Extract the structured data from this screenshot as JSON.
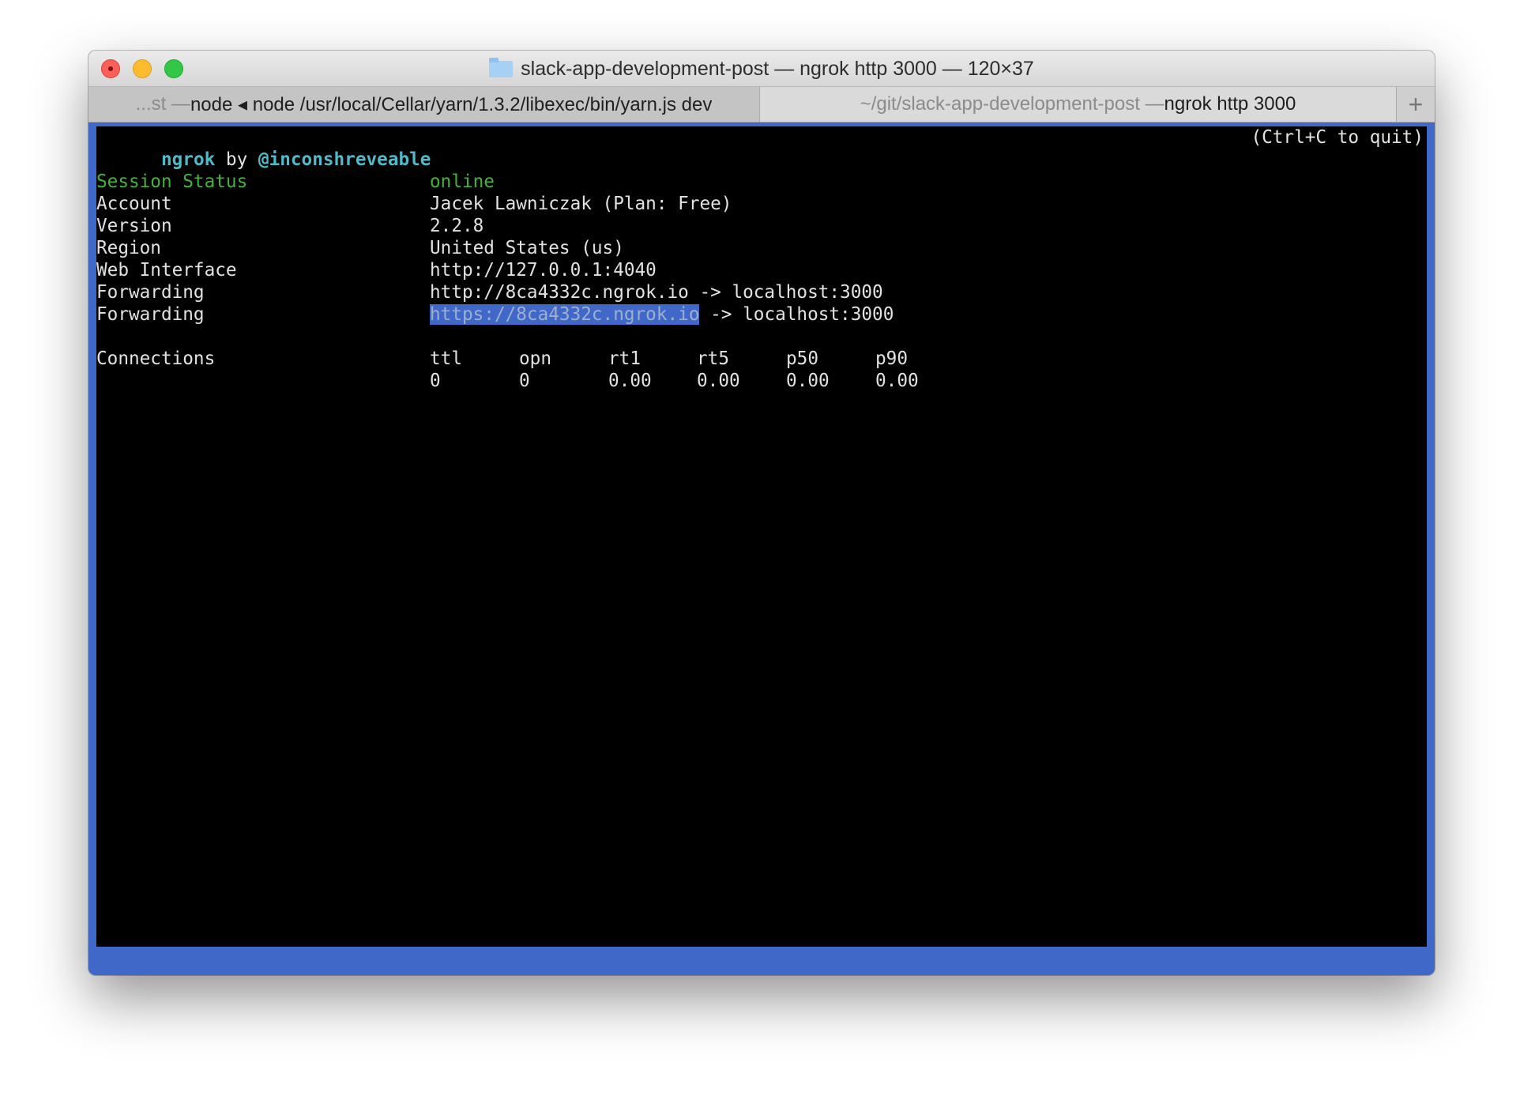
{
  "window": {
    "title": "slack-app-development-post — ngrok http 3000 — 120×37",
    "folder_icon": "folder-icon",
    "colors": {
      "selection": "#3f68c8",
      "accent_cyan": "#52b9c8",
      "status_green": "#46b13c",
      "background": "#000000"
    }
  },
  "tabs": [
    {
      "prefix": "...st — ",
      "label": "node ◂ node /usr/local/Cellar/yarn/1.3.2/libexec/bin/yarn.js dev"
    },
    {
      "prefix": "~/git/slack-app-development-post — ",
      "label": "ngrok http 3000"
    }
  ],
  "newtab_label": "+",
  "terminal": {
    "header": {
      "app": "ngrok",
      "by": " by ",
      "author": "@inconshreveable",
      "quit_hint": "(Ctrl+C to quit)"
    },
    "session": {
      "label": "Session Status",
      "value": "online"
    },
    "fields": [
      {
        "label": "Account",
        "value": "Jacek Lawniczak (Plan: Free)"
      },
      {
        "label": "Version",
        "value": "2.2.8"
      },
      {
        "label": "Region",
        "value": "United States (us)"
      },
      {
        "label": "Web Interface",
        "value": "http://127.0.0.1:4040"
      },
      {
        "label": "Forwarding",
        "value": "http://8ca4332c.ngrok.io -> localhost:3000"
      }
    ],
    "forwarding_https": {
      "label": "Forwarding",
      "selected_url": "https://8ca4332c.ngrok.io",
      "rest": " -> localhost:3000"
    },
    "connections": {
      "label": "Connections",
      "headers": [
        "ttl",
        "opn",
        "rt1",
        "rt5",
        "p50",
        "p90"
      ],
      "values": [
        "0",
        "0",
        "0.00",
        "0.00",
        "0.00",
        "0.00"
      ]
    }
  }
}
